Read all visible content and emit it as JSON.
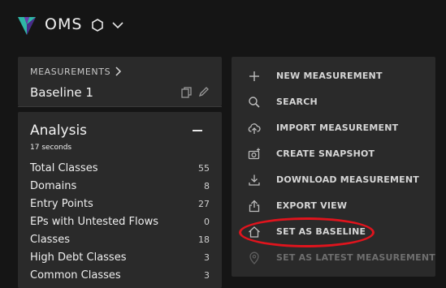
{
  "header": {
    "app_title": "OMS"
  },
  "measurement": {
    "breadcrumb": "MEASUREMENTS",
    "name": "Baseline 1"
  },
  "analysis": {
    "title": "Analysis",
    "subtitle": "17 seconds",
    "rows": [
      {
        "label": "Total Classes",
        "value": "55"
      },
      {
        "label": "Domains",
        "value": "8"
      },
      {
        "label": "Entry Points",
        "value": "27"
      },
      {
        "label": "EPs with Untested Flows",
        "value": "0"
      },
      {
        "label": "Classes",
        "value": "18"
      },
      {
        "label": "High Debt Classes",
        "value": "3"
      },
      {
        "label": "Common Classes",
        "value": "3"
      }
    ]
  },
  "menu": {
    "items": [
      {
        "label": "NEW MEASUREMENT",
        "icon": "plus-icon"
      },
      {
        "label": "SEARCH",
        "icon": "search-icon"
      },
      {
        "label": "IMPORT MEASUREMENT",
        "icon": "cloud-upload-icon"
      },
      {
        "label": "CREATE SNAPSHOT",
        "icon": "camera-add-icon"
      },
      {
        "label": "DOWNLOAD MEASUREMENT",
        "icon": "download-icon"
      },
      {
        "label": "EXPORT VIEW",
        "icon": "export-icon"
      },
      {
        "label": "SET AS BASELINE",
        "icon": "home-icon"
      },
      {
        "label": "SET AS LATEST MEASUREMENT",
        "icon": "location-pin-icon",
        "disabled": true
      }
    ]
  },
  "colors": {
    "background": "#151515",
    "panel": "#2a2a2a",
    "highlight": "#e0141d",
    "logo_a": "#2fb6a6",
    "logo_b": "#6a3fb0"
  }
}
